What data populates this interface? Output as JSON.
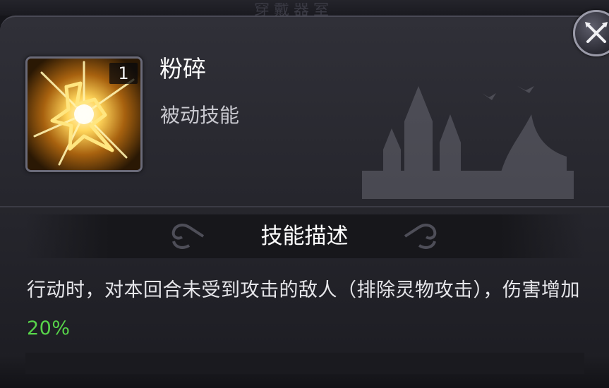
{
  "skill": {
    "name": "粉碎",
    "type": "被动技能",
    "level": "1",
    "icon": "shatter-burst-icon"
  },
  "section": {
    "title": "技能描述"
  },
  "description": {
    "text": "行动时，对本回合未受到攻击的敌人（排除灵物攻击），伤害增加",
    "highlight": "20%"
  },
  "colors": {
    "highlight": "#57d44a",
    "panel": "#2c2c34",
    "text": "#e6e6ea"
  },
  "close_icon": "close-x-icon"
}
